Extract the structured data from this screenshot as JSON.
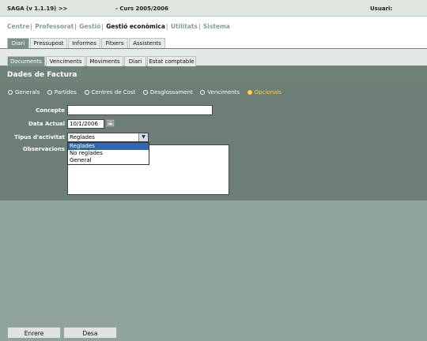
{
  "topbar": {
    "app": "SAGA (v 1.1.19) >>",
    "course": "- Curs 2005/2006",
    "user_label": "Usuari:"
  },
  "modules": [
    {
      "label": "Centre",
      "active": false
    },
    {
      "label": "Professorat",
      "active": false
    },
    {
      "label": "Gestió",
      "active": false
    },
    {
      "label": "Gestió econòmica",
      "active": true
    },
    {
      "label": "Utilitats",
      "active": false
    },
    {
      "label": "Sistema",
      "active": false
    }
  ],
  "tabs1": [
    "Diari",
    "Pressupost",
    "Informes",
    "Fitxers",
    "Assistents"
  ],
  "tabs2": [
    "Documents",
    "Venciments",
    "Moviments",
    "Diari",
    "Estat comptable"
  ],
  "section_title": "Dades de Factura",
  "radios": [
    "Generals",
    "Partides",
    "Centres de Cost",
    "Desglossament",
    "Venciments",
    "Opcionals"
  ],
  "selected_radio": "Opcionals",
  "form": {
    "concepte_label": "Concepte",
    "concepte_value": "",
    "data_label": "Data Actual",
    "data_value": "10/1/2006",
    "tipus_label": "Tipus d'activitat",
    "tipus_value": "Reglades",
    "tipus_options": [
      "Reglades",
      "No reglades",
      "General"
    ],
    "observacions_label": "Observacions"
  },
  "buttons": {
    "enter": "Enrere",
    "desa": "Desa"
  }
}
